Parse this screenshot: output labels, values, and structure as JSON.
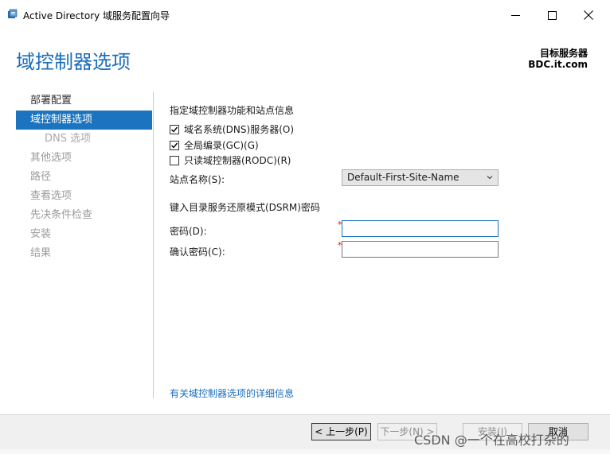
{
  "window": {
    "title": "Active Directory 域服务配置向导"
  },
  "header": {
    "page_title": "域控制器选项",
    "target_label": "目标服务器",
    "target_value": "BDC.it.com"
  },
  "nav": {
    "items": [
      {
        "label": "部署配置",
        "state": "enabled"
      },
      {
        "label": "域控制器选项",
        "state": "active"
      },
      {
        "label": "DNS 选项",
        "state": "sub-disabled"
      },
      {
        "label": "其他选项",
        "state": "disabled"
      },
      {
        "label": "路径",
        "state": "disabled"
      },
      {
        "label": "查看选项",
        "state": "disabled"
      },
      {
        "label": "先决条件检查",
        "state": "disabled"
      },
      {
        "label": "安装",
        "state": "disabled"
      },
      {
        "label": "结果",
        "state": "disabled"
      }
    ]
  },
  "main": {
    "section1_title": "指定域控制器功能和站点信息",
    "checkboxes": [
      {
        "label": "域名系统(DNS)服务器(O)",
        "checked": true
      },
      {
        "label": "全局编录(GC)(G)",
        "checked": true
      },
      {
        "label": "只读域控制器(RODC)(R)",
        "checked": false
      }
    ],
    "site_label": "站点名称(S):",
    "site_value": "Default-First-Site-Name",
    "section2_title": "键入目录服务还原模式(DSRM)密码",
    "password_label": "密码(D):",
    "confirm_label": "确认密码(C):",
    "required_mark": "*",
    "password_value": "",
    "confirm_value": "",
    "more_link": "有关域控制器选项的详细信息"
  },
  "footer": {
    "prev_label": "< 上一步(P)",
    "next_label": "下一步(N) >",
    "install_label": "安装(I)",
    "cancel_label": "取消",
    "watermark": "CSDN @一个在高校打杂的"
  }
}
